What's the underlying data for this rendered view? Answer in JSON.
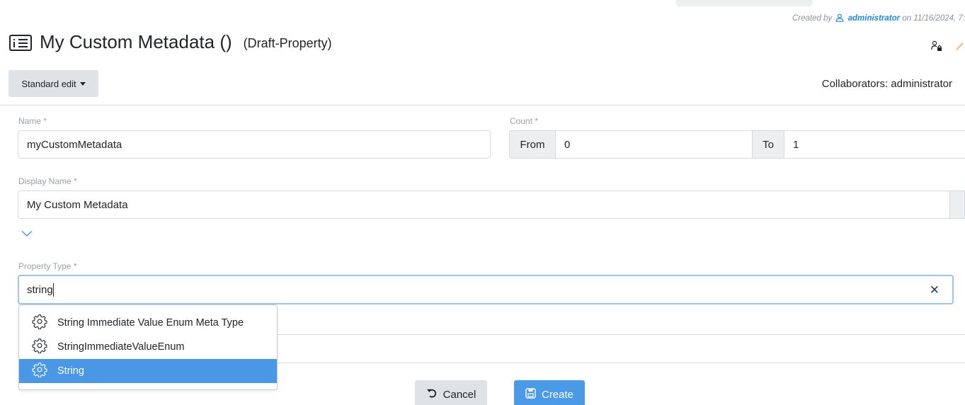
{
  "meta": {
    "created_prefix": "Created by",
    "author": "administrator",
    "created_suffix": "on 11/16/2024, 7:"
  },
  "header": {
    "title": "My Custom Metadata ()",
    "status": "(Draft-Property)",
    "icons": [
      "list-card-icon",
      "user-lock-icon",
      "edit-icon"
    ]
  },
  "toolbar": {
    "edit_mode_label": "Standard edit",
    "collaborators_label": "Collaborators: administrator"
  },
  "form": {
    "name": {
      "label": "Name *",
      "value": "myCustomMetadata"
    },
    "count": {
      "label": "Count *",
      "from_label": "From",
      "from_value": "0",
      "to_label": "To",
      "to_value": "1"
    },
    "display_name": {
      "label": "Display Name *",
      "value": "My Custom Metadata"
    },
    "property_type": {
      "label": "Property Type *",
      "value": "string",
      "options": [
        {
          "label": "String Immediate Value Enum Meta Type",
          "icon": "gear-icon",
          "selected": false
        },
        {
          "label": "StringImmediateValueEnum",
          "icon": "gear-icon",
          "selected": false
        },
        {
          "label": "String",
          "icon": "gear-icon",
          "selected": true
        }
      ]
    }
  },
  "actions": {
    "cancel_label": "Cancel",
    "create_label": "Create"
  },
  "colors": {
    "accent": "#4a97e6",
    "link": "#1e88e5",
    "focus_border": "#9cc4ee"
  }
}
